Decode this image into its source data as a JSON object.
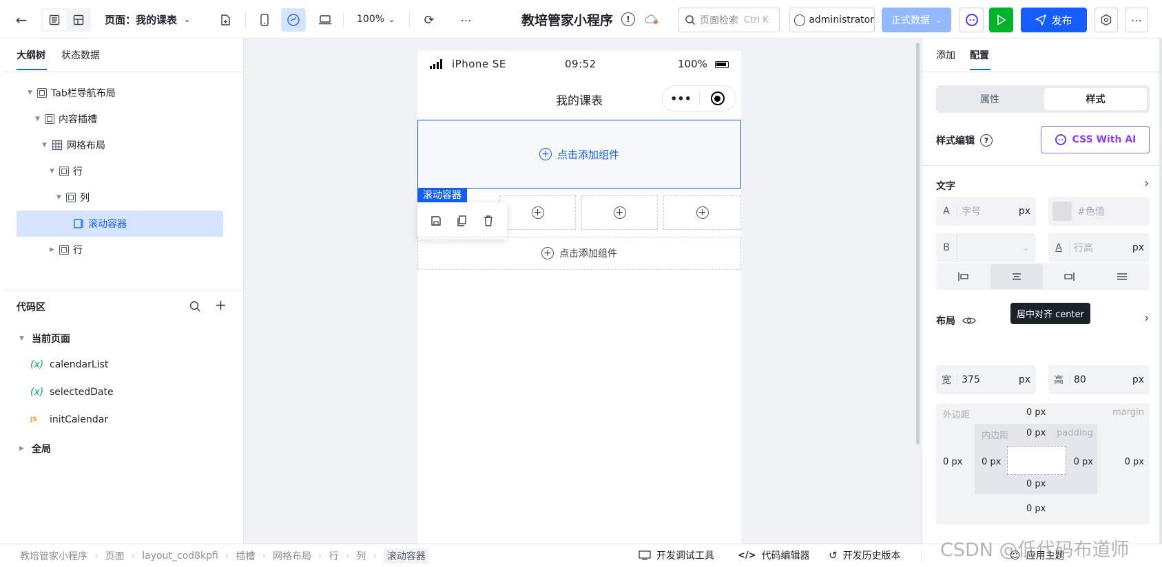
{
  "topbar": {
    "page_label": "页面：我的课表",
    "zoom": "100%",
    "app_title": "教培管家小程序",
    "search_placeholder": "页面检索",
    "search_shortcut": "Ctrl K",
    "user": "administrator",
    "data_env": "正式数据",
    "publish": "发布"
  },
  "left": {
    "tabs": [
      "大纲树",
      "状态数据"
    ],
    "tree": [
      {
        "label": "Tab栏导航布局"
      },
      {
        "label": "内容插槽"
      },
      {
        "label": "网格布局"
      },
      {
        "label": "行"
      },
      {
        "label": "列"
      },
      {
        "label": "滚动容器"
      },
      {
        "label": "行"
      }
    ],
    "code_title": "代码区",
    "current_page": "当前页面",
    "code_items": [
      {
        "icon": "(x)",
        "label": "calendarList"
      },
      {
        "icon": "(x)",
        "label": "selectedDate"
      },
      {
        "icon": "JS",
        "label": "initCalendar"
      }
    ],
    "global": "全局"
  },
  "phone": {
    "carrier": "iPhone SE",
    "time": "09:52",
    "battery": "100%",
    "title": "我的课表",
    "add_component": "点击添加组件",
    "selected_tag": "滚动容器",
    "add_component_2": "点击添加组件"
  },
  "right": {
    "tabs": [
      "添加",
      "配置"
    ],
    "seg": [
      "属性",
      "样式"
    ],
    "style_edit": "样式编辑",
    "css_ai": "CSS With AI",
    "text_section": "文字",
    "font_size_ph": "字号",
    "unit_px": "px",
    "color_ph": "#色值",
    "bold_label": "B",
    "line_height_ph": "行高",
    "layout_section": "布局",
    "tooltip": "居中对齐 center",
    "width_label": "宽",
    "width_val": "375",
    "height_label": "高",
    "height_val": "80",
    "margin_label": "外边距",
    "margin_en": "margin",
    "padding_label": "内边距",
    "padding_en": "padding",
    "zero_px": "0 px"
  },
  "bottom": {
    "crumbs": [
      "教培管家小程序",
      "页面",
      "layout_cod8kpfi",
      "插槽",
      "网格布局",
      "行",
      "列",
      "滚动容器"
    ],
    "dev_tools": "开发调试工具",
    "code_editor": "代码编辑器",
    "history": "开发历史版本",
    "theme": "应用主题",
    "watermark": "CSDN @低代码布道师"
  }
}
